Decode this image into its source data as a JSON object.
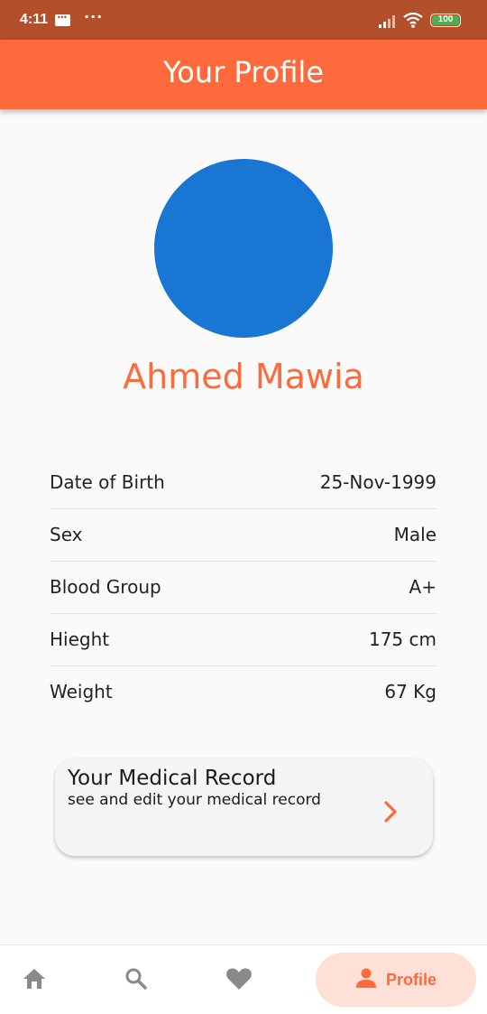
{
  "status_bar": {
    "time": "4:11",
    "dots": "···",
    "battery": "100",
    "battery_color": "#4caf50"
  },
  "app_bar": {
    "title": "Your Profile",
    "color": "#ff6a3d"
  },
  "profile": {
    "name": "Ahmed Mawia",
    "avatar_color": "#1976d2"
  },
  "info": [
    {
      "label": "Date of Birth",
      "value": "25-Nov-1999"
    },
    {
      "label": "Sex",
      "value": "Male"
    },
    {
      "label": "Blood Group",
      "value": "A+"
    },
    {
      "label": "Hieght",
      "value": "175 cm"
    },
    {
      "label": "Weight",
      "value": "67 Kg"
    }
  ],
  "medical_record": {
    "title": "Your Medical Record",
    "subtitle": "see and edit your medical record",
    "chevron_icon": "chevron-right-icon"
  },
  "bottom_nav": {
    "items": [
      {
        "icon": "home-icon"
      },
      {
        "icon": "search-icon"
      },
      {
        "icon": "heart-icon"
      },
      {
        "icon": "person-icon",
        "label": "Profile",
        "active": true
      }
    ],
    "active_color": "#ff6a3d",
    "inactive_color": "#8a8a8a"
  }
}
